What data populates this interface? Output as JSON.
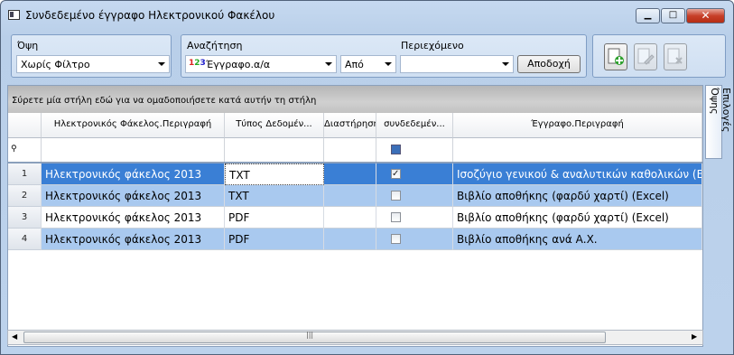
{
  "window": {
    "title": "Συνδεδεμένο έγγραφο Ηλεκτρονικού Φακέλου"
  },
  "view_panel": {
    "label": "Όψη",
    "value": "Χωρίς Φίλτρο"
  },
  "search_panel": {
    "label": "Αναζήτηση",
    "field_value": "Έγγραφο.α/α",
    "operator_value": "Από",
    "content_label": "Περιεχόμενο",
    "content_value": "",
    "accept_label": "Αποδοχή"
  },
  "grid": {
    "group_hint": "Σύρετε μία στήλη εδώ για να ομαδοποιήσετε κατά αυτήν τη στήλη",
    "columns": [
      "Ηλεκτρονικός Φάκελος.Περιγραφή",
      "Τύπος Δεδομέν...",
      "Διαστήρηση",
      "συνδεδεμέν...",
      "Έγγραφο.Περιγραφή"
    ],
    "rows": [
      {
        "num": "1",
        "folder": "Ηλεκτρονικός φάκελος 2013",
        "type": "TXT",
        "linked": true,
        "desc": "Ισοζύγιο γενικού & αναλυτικών καθολικών (Excel)"
      },
      {
        "num": "2",
        "folder": "Ηλεκτρονικός φάκελος 2013",
        "type": "TXT",
        "linked": false,
        "desc": "Βιβλίο αποθήκης (φαρδύ χαρτί) (Excel)"
      },
      {
        "num": "3",
        "folder": "Ηλεκτρονικός φάκελος 2013",
        "type": "PDF",
        "linked": false,
        "desc": "Βιβλίο αποθήκης (φαρδύ χαρτί) (Excel)"
      },
      {
        "num": "4",
        "folder": "Ηλεκτρονικός φάκελος 2013",
        "type": "PDF",
        "linked": false,
        "desc": "Βιβλίο αποθήκης ανά Α.Χ."
      }
    ]
  },
  "side_tab": {
    "label": "Επιλογές Όψης"
  },
  "colors": {
    "selected_row": "#3a7fd5",
    "alt_row": "#a9c9ef",
    "white_row": "#ffffff"
  }
}
